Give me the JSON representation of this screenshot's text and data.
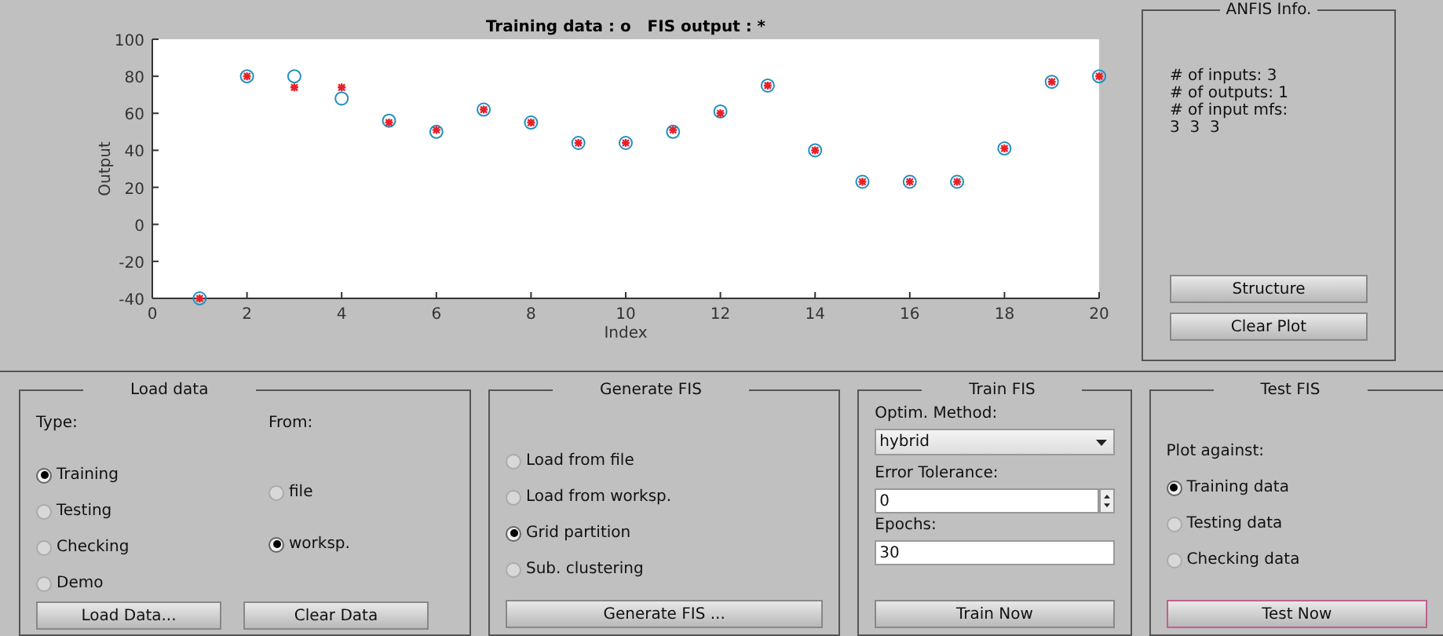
{
  "plot": {
    "chart_data": {
      "type": "scatter",
      "title": "Training data : o   FIS output : *",
      "xlabel": "Index",
      "ylabel": "Output",
      "x": [
        1,
        2,
        3,
        4,
        5,
        6,
        7,
        8,
        9,
        10,
        11,
        12,
        13,
        14,
        15,
        16,
        17,
        18,
        19,
        20
      ],
      "series": [
        {
          "color": "#1f8fbf",
          "values": [
            -40,
            80,
            80,
            68,
            56,
            50,
            62,
            55,
            44,
            44,
            50,
            61,
            75,
            40,
            23,
            23,
            23,
            41,
            77,
            80
          ]
        },
        {
          "color": "#e8202a",
          "values": [
            -40,
            80,
            74,
            74,
            55,
            51,
            62,
            55,
            44,
            44,
            51,
            60,
            75,
            40,
            23,
            23,
            23,
            41,
            77,
            80
          ]
        }
      ],
      "xlim": [
        0,
        20
      ],
      "ylim": [
        -40,
        100
      ],
      "xticks": [
        0,
        2,
        4,
        6,
        8,
        10,
        12,
        14,
        16,
        18,
        20
      ],
      "yticks": [
        -40,
        -20,
        0,
        20,
        40,
        60,
        80,
        100
      ]
    }
  },
  "anfis_info": {
    "title": "ANFIS Info.",
    "lines": [
      "# of inputs: 3",
      "# of outputs: 1",
      "# of input mfs:",
      "3  3  3"
    ],
    "buttons": [
      "Structure",
      "Clear Plot"
    ]
  },
  "load_data": {
    "title": "Load data",
    "type_label": "Type:",
    "from_label": "From:",
    "type_options": [
      {
        "label": "Training",
        "selected": true
      },
      {
        "label": "Testing",
        "selected": false
      },
      {
        "label": "Checking",
        "selected": false
      },
      {
        "label": "Demo",
        "selected": false
      }
    ],
    "from_options": [
      {
        "label": "file",
        "selected": false
      },
      {
        "label": "worksp.",
        "selected": true
      }
    ],
    "buttons": [
      "Load Data...",
      "Clear Data"
    ]
  },
  "generate_fis": {
    "title": "Generate FIS",
    "options": [
      {
        "label": "Load from file",
        "selected": false
      },
      {
        "label": "Load from worksp.",
        "selected": false
      },
      {
        "label": "Grid partition",
        "selected": true
      },
      {
        "label": "Sub. clustering",
        "selected": false
      }
    ],
    "button": "Generate FIS ..."
  },
  "train_fis": {
    "title": "Train FIS",
    "method_label": "Optim. Method:",
    "method": "hybrid",
    "tolerance_label": "Error Tolerance:",
    "tolerance": "0",
    "epochs_label": "Epochs:",
    "epochs": "30",
    "button": "Train Now"
  },
  "test_fis": {
    "title": "Test FIS",
    "label": "Plot against:",
    "options": [
      {
        "label": "Training data",
        "selected": true
      },
      {
        "label": "Testing data",
        "selected": false
      },
      {
        "label": "Checking data",
        "selected": false
      }
    ],
    "button": {
      "label": "Test Now",
      "focused": true
    }
  }
}
